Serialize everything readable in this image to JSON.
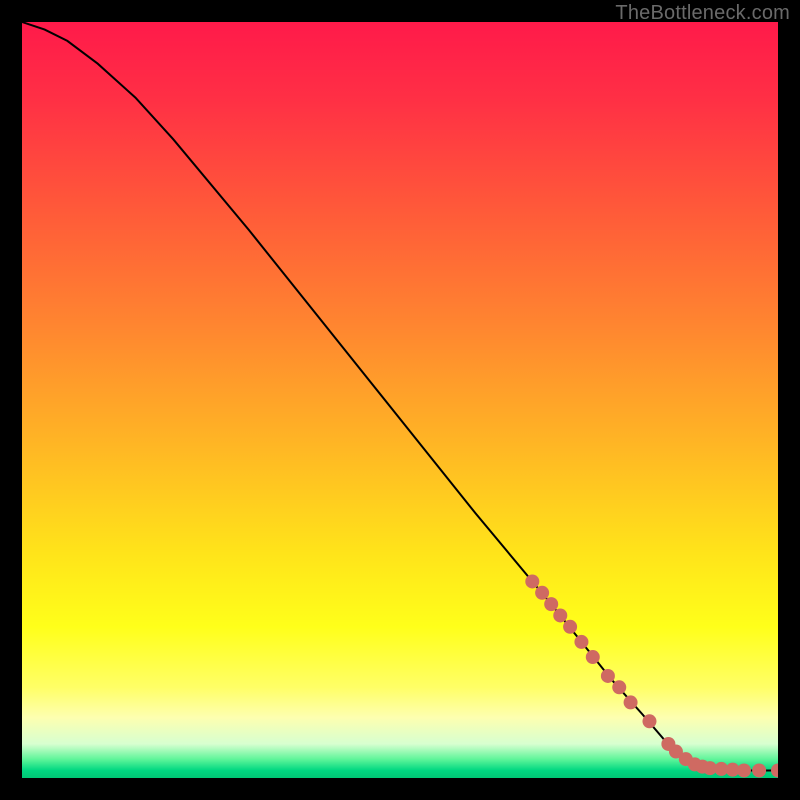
{
  "watermark": "TheBottleneck.com",
  "colors": {
    "background": "#000000",
    "curve": "#000000",
    "marker_fill": "#cf6a62",
    "marker_stroke": "#cf6a62",
    "gradient_stops": [
      {
        "offset": 0.0,
        "color": "#ff1a4a"
      },
      {
        "offset": 0.1,
        "color": "#ff2f45"
      },
      {
        "offset": 0.25,
        "color": "#ff5a39"
      },
      {
        "offset": 0.4,
        "color": "#ff8530"
      },
      {
        "offset": 0.55,
        "color": "#ffb325"
      },
      {
        "offset": 0.7,
        "color": "#ffe31a"
      },
      {
        "offset": 0.8,
        "color": "#ffff1a"
      },
      {
        "offset": 0.88,
        "color": "#ffff66"
      },
      {
        "offset": 0.92,
        "color": "#fdffb0"
      },
      {
        "offset": 0.955,
        "color": "#d7ffd0"
      },
      {
        "offset": 0.975,
        "color": "#60f59a"
      },
      {
        "offset": 0.99,
        "color": "#00d781"
      },
      {
        "offset": 1.0,
        "color": "#00c775"
      }
    ]
  },
  "chart_data": {
    "type": "line",
    "title": "",
    "xlabel": "",
    "ylabel": "",
    "xlim": [
      0,
      100
    ],
    "ylim": [
      0,
      100
    ],
    "series": [
      {
        "name": "curve",
        "x": [
          0,
          3,
          6,
          10,
          15,
          20,
          30,
          40,
          50,
          60,
          70,
          78,
          82,
          85,
          88,
          90,
          92,
          94,
          96,
          98,
          100
        ],
        "y": [
          100,
          99,
          97.5,
          94.5,
          90,
          84.5,
          72.5,
          60,
          47.5,
          35,
          23,
          13,
          8.5,
          5,
          2.5,
          1.5,
          1.2,
          1.1,
          1.0,
          1.0,
          1.0
        ]
      }
    ],
    "markers": {
      "name": "highlighted-points",
      "x": [
        67.5,
        68.8,
        70.0,
        71.2,
        72.5,
        74.0,
        75.5,
        77.5,
        79.0,
        80.5,
        83.0,
        85.5,
        86.5,
        87.8,
        89.0,
        90.0,
        91.0,
        92.5,
        94.0,
        95.5,
        97.5,
        100.0
      ],
      "y": [
        26.0,
        24.5,
        23.0,
        21.5,
        20.0,
        18.0,
        16.0,
        13.5,
        12.0,
        10.0,
        7.5,
        4.5,
        3.5,
        2.5,
        1.8,
        1.5,
        1.3,
        1.2,
        1.1,
        1.0,
        1.0,
        1.0
      ]
    }
  }
}
